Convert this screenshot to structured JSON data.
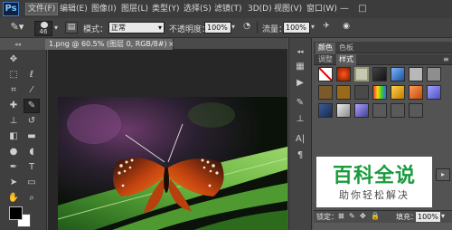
{
  "app": {
    "logo": "Ps"
  },
  "menu": [
    "文件(F)",
    "编辑(E)",
    "图像(I)",
    "图层(L)",
    "类型(Y)",
    "选择(S)",
    "滤镜(T)",
    "3D(D)",
    "视图(V)",
    "窗口(W)"
  ],
  "options": {
    "size_value": "46",
    "mode_label": "模式：",
    "mode_value": "正常",
    "opacity_label": "不透明度：",
    "opacity_value": "100%",
    "flow_label": "流量：",
    "flow_value": "100%"
  },
  "document": {
    "tab_title": "1.png @ 60.5% (图层 0, RGB/8#)",
    "close": "×"
  },
  "panels": {
    "color_tab": "颜色",
    "swatches_tab": "色板",
    "adjust_tab": "调整",
    "styles_tab": "样式"
  },
  "layers": {
    "lock_label": "锁定：",
    "fill_label": "填充：",
    "fill_value": "100%"
  },
  "watermark": {
    "title": "百科全说",
    "subtitle": "助你轻松解决"
  },
  "colors": {
    "foreground": "#000000",
    "background": "#ffffff",
    "watermark_green": "#1a9b3c"
  }
}
